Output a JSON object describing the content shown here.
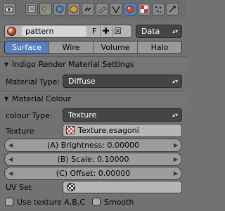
{
  "toolbar": {
    "icons": [
      "render-icon",
      "render-layers-icon",
      "scene-icon",
      "world-icon",
      "object-icon",
      "constraints-icon",
      "modifiers-icon",
      "data-icon",
      "material-icon",
      "texture-icon",
      "particles-icon",
      "physics-icon"
    ],
    "active": "material-icon"
  },
  "datablock": {
    "name": "pattern",
    "fake_user_label": "F",
    "type_label": "Data"
  },
  "tabs": [
    "Surface",
    "Wire",
    "Volume",
    "Halo"
  ],
  "active_tab": "Surface",
  "indigo_panel": {
    "title": "Indigo Render Material Settings",
    "material_type_label": "Material Type:",
    "material_type_value": "Diffuse"
  },
  "colour_panel": {
    "title": "Material Colour",
    "colour_type_label": "colour Type:",
    "colour_type_value": "Texture",
    "texture_label": "Texture",
    "texture_value": "Texture.esagoni",
    "brightness": "(A) Brightness: 0.00000",
    "scale": "(B) Scale: 0.10000",
    "offset": "(C) Offset: 0.00000",
    "uv_set_label": "UV Set",
    "use_texture_label": "Use texture A,B,C",
    "smooth_label": "Smooth"
  },
  "colors": {
    "accent": "#5680c2",
    "panel_bg": "#727272"
  }
}
